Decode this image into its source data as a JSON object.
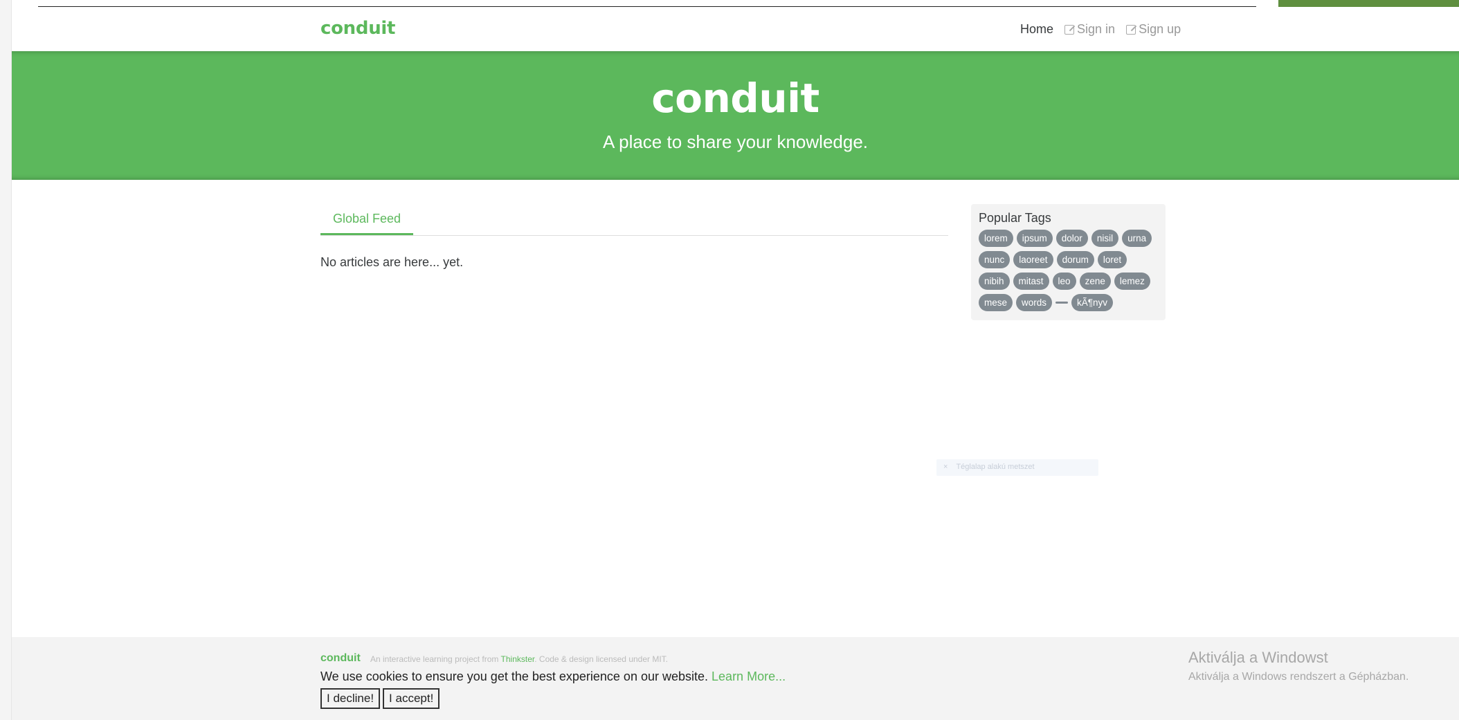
{
  "navbar": {
    "brand": "conduit",
    "links": [
      {
        "label": "Home"
      },
      {
        "label": "Sign in"
      },
      {
        "label": "Sign up"
      }
    ]
  },
  "banner": {
    "title": "conduit",
    "subtitle": "A place to share your knowledge."
  },
  "feed": {
    "tab_label": "Global Feed",
    "empty_message": "No articles are here... yet."
  },
  "sidebar": {
    "title": "Popular Tags",
    "tags": [
      "lorem",
      "ipsum",
      "dolor",
      "nisil",
      "urna",
      "nunc",
      "laoreet",
      "dorum",
      "loret",
      "nibih",
      "mitast",
      "leo",
      "zene",
      "lemez",
      "mese",
      "words",
      "",
      "kÃ¶nyv"
    ]
  },
  "ghost": {
    "text": "Téglalap alakú metszet"
  },
  "footer": {
    "brand": "conduit",
    "attribution_prefix": "An interactive learning project from",
    "attribution_link": "Thinkster",
    "attribution_suffix": ". Code & design licensed under MIT.",
    "cookie_text": "We use cookies to ensure you get the best experience on our website.",
    "cookie_learn": "Learn More...",
    "decline_label": "I decline!",
    "accept_label": "I accept!"
  },
  "os_overlay": {
    "title": "Aktiválja a Windowst",
    "subtitle": "Aktiválja a Windows rendszert a Gépházban."
  },
  "colors": {
    "brand": "#5cb85c",
    "tag_bg": "#818a91",
    "footer_bg": "#f3f3f3"
  }
}
